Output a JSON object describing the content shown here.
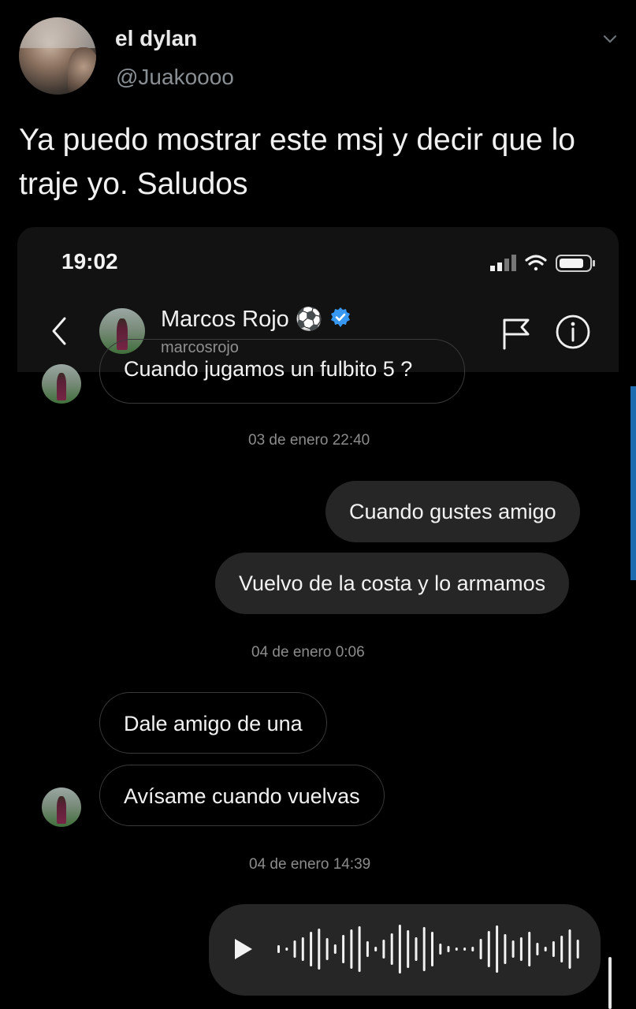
{
  "tweet": {
    "author_name": "el dylan",
    "author_handle": "@Juakoooo",
    "text": "Ya puedo mostrar este msj y decir que lo traje yo. Saludos"
  },
  "screenshot": {
    "status_time": "19:02",
    "chat": {
      "name": "Marcos Rojo",
      "name_emoji": "⚽",
      "username": "marcosrojo",
      "verified": true
    },
    "messages": {
      "cut_off_text": "Cuando jugamos un fulbito 5 ?",
      "stamp_1": "03 de enero 22:40",
      "out_1": "Cuando gustes amigo",
      "out_2": "Vuelvo de la costa y lo armamos",
      "stamp_2": "04 de enero 0:06",
      "in_1": "Dale amigo de una",
      "in_2": "Avísame cuando vuelvas",
      "stamp_3": "04 de enero 14:39"
    }
  },
  "colors": {
    "background": "#000000",
    "bubble_out": "#262626",
    "verified_badge": "#3897f0",
    "scroll_accent": "#1e6bb0"
  },
  "icons": [
    "chevron-down-icon",
    "back-arrow-icon",
    "flag-icon",
    "info-icon",
    "verified-badge-icon",
    "play-icon",
    "cellular-signal-icon",
    "wifi-icon",
    "battery-icon"
  ]
}
